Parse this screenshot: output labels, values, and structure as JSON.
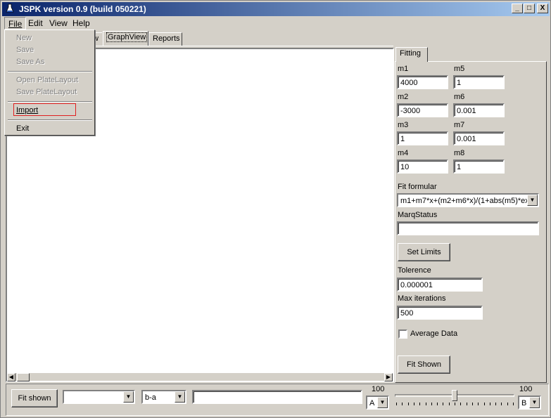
{
  "window": {
    "title": "JSPK version 0.9 (build 050221)"
  },
  "caption_buttons": {
    "minimize": "_",
    "maximize": "□",
    "close": "X"
  },
  "menubar": {
    "file": "File",
    "edit": "Edit",
    "view": "View",
    "help": "Help"
  },
  "file_menu": {
    "new": "New",
    "save": "Save",
    "save_as": "Save As",
    "open_plate_layout": "Open PlateLayout",
    "save_plate_layout": "Save PlateLayout",
    "import": "Import",
    "exit": "Exit"
  },
  "tabs": {
    "hidden_partial": "w",
    "graph_view": "GraphView",
    "reports": "Reports"
  },
  "fitting": {
    "tab_label": "Fitting",
    "params": [
      {
        "label": "m1",
        "value": "4000"
      },
      {
        "label": "m5",
        "value": "1"
      },
      {
        "label": "m2",
        "value": "-3000"
      },
      {
        "label": "m6",
        "value": "0.001"
      },
      {
        "label": "m3",
        "value": "1"
      },
      {
        "label": "m7",
        "value": "0.001"
      },
      {
        "label": "m4",
        "value": "10"
      },
      {
        "label": "m8",
        "value": "1"
      }
    ],
    "formula_label": "Fit formular",
    "formula_value": "m1+m7*x+(m2+m6*x)/(1+abs(m5)*exp(",
    "marq_label": "MarqStatus",
    "marq_value": "",
    "set_limits": "Set Limits",
    "tolerance_label": "Tolerence",
    "tolerance_value": "0.000001",
    "max_iter_label": "Max iterations",
    "max_iter_value": "500",
    "average_label": "Average Data",
    "average_checked": false,
    "fit_shown": "Fit Shown"
  },
  "bottom": {
    "fit_shown": "Fit shown",
    "combo1_value": "",
    "combo2_value": "b-a",
    "text_value": "",
    "left_max": "100",
    "left_select": "A",
    "right_max": "100",
    "right_select": "B",
    "slider_fraction": 0.5
  }
}
